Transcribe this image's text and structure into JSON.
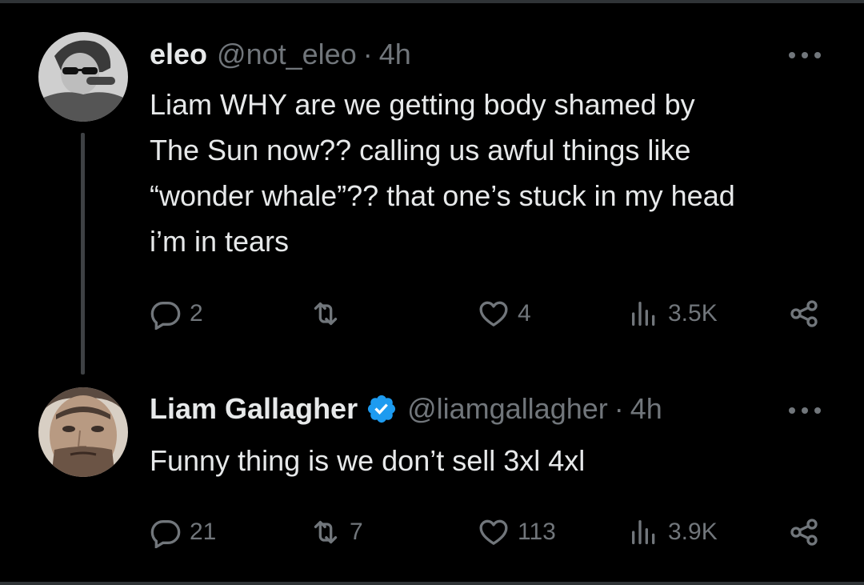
{
  "tweets": [
    {
      "name": "eleo",
      "handle": "@not_eleo",
      "separator": "·",
      "time": "4h",
      "verified": false,
      "text_lines": [
        "Liam WHY are we getting body shamed by",
        "The Sun now?? calling us awful things like",
        "“wonder whale”?? that one’s stuck in my head",
        "i’m in tears"
      ],
      "replies": "2",
      "retweets": "",
      "likes": "4",
      "views": "3.5K"
    },
    {
      "name": "Liam Gallagher",
      "handle": "@liamgallagher",
      "separator": "·",
      "time": "4h",
      "verified": true,
      "text_lines": [
        "Funny thing is we don’t sell 3xl 4xl"
      ],
      "replies": "21",
      "retweets": "7",
      "likes": "113",
      "views": "3.9K"
    }
  ],
  "colors": {
    "background": "#000000",
    "text": "#e7e9ea",
    "secondary": "#71767b",
    "verified": "#1d9bf0",
    "thread_line": "#3e4144"
  },
  "icons": {
    "reply": "reply-icon",
    "retweet": "retweet-icon",
    "like": "heart-icon",
    "views": "views-icon",
    "share": "share-icon",
    "more": "more-options-icon",
    "verified": "verified-badge-icon"
  }
}
